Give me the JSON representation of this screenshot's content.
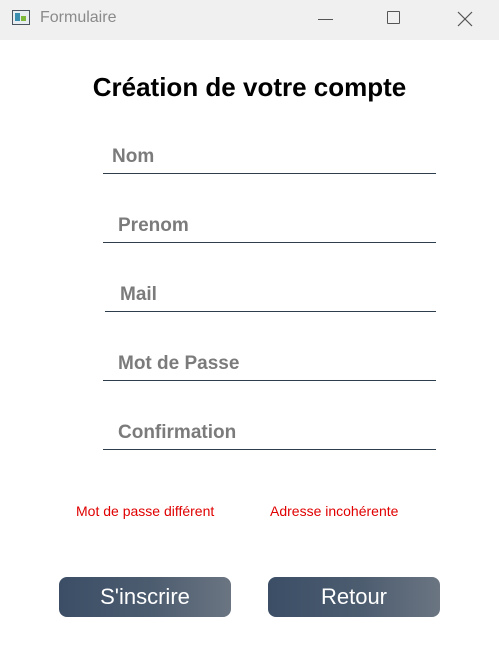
{
  "window": {
    "title": "Formulaire",
    "icon": "form-app-icon",
    "controls": [
      "minimize-icon",
      "maximize-icon",
      "close-icon"
    ]
  },
  "form": {
    "heading": "Création de votre compte",
    "fields": {
      "nom": {
        "value": "",
        "placeholder": "Nom"
      },
      "prenom": {
        "value": "",
        "placeholder": "Prenom"
      },
      "mail": {
        "value": "",
        "placeholder": "Mail"
      },
      "password": {
        "value": "",
        "placeholder": "Mot de Passe"
      },
      "confirmation": {
        "value": "",
        "placeholder": "Confirmation"
      }
    },
    "errors": {
      "password_mismatch": "Mot de passe différent",
      "address_invalid": "Adresse incohérente"
    },
    "buttons": {
      "register": "S'inscrire",
      "back": "Retour"
    }
  },
  "colors": {
    "error": "#e00000",
    "button_gradient_start": "#3b4e66",
    "button_gradient_end": "#6b7582",
    "underline": "#2f3e4c"
  }
}
